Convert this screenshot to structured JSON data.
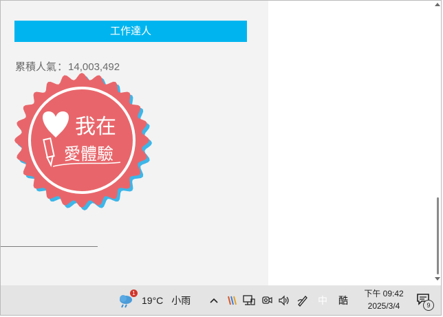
{
  "main": {
    "section_button": "工作達人",
    "popularity_label": "累積人氣",
    "popularity_sep": "：",
    "popularity_value": "14,003,492",
    "badge": {
      "line1": "我在",
      "line2": "愛體驗"
    }
  },
  "taskbar": {
    "weather": {
      "badge_count": "1",
      "temperature": "19°C",
      "condition": "小雨"
    },
    "ime_mode": "中",
    "ime_extra": "酷",
    "clock": {
      "time": "下午 09:42",
      "date": "2025/3/4"
    },
    "notification_count": "9"
  },
  "colors": {
    "accent": "#00b5ef",
    "badge_red": "#e8666b",
    "badge_shadow": "#3db6e8",
    "panel_bg": "#f3f3f3",
    "taskbar_bg": "#e4e4e4"
  }
}
